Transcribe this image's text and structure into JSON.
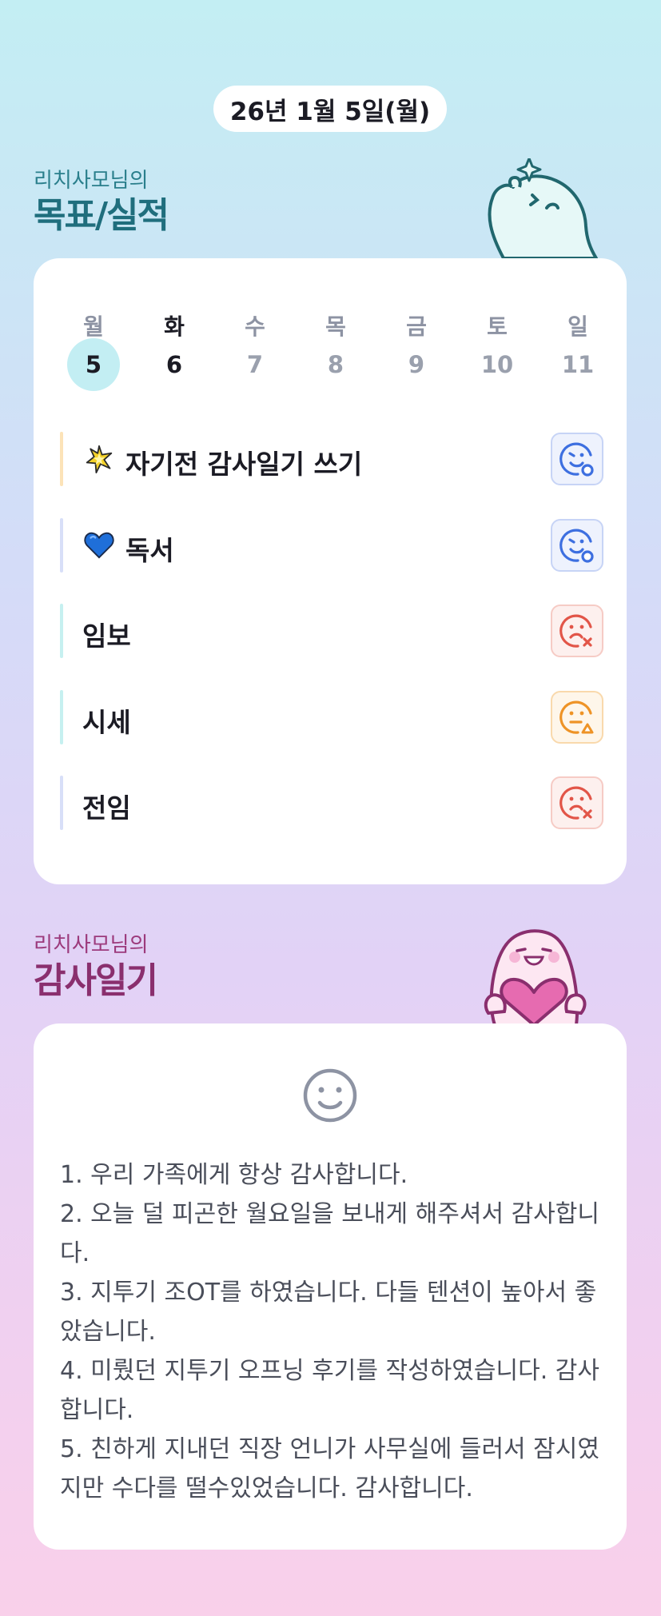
{
  "header": {
    "date": "26년 1월 5일(월)"
  },
  "goals_section": {
    "subtitle": "리치사모님의",
    "title": "목표/실적"
  },
  "week": {
    "weekdays": [
      "월",
      "화",
      "수",
      "목",
      "금",
      "토",
      "일"
    ],
    "days": [
      "5",
      "6",
      "7",
      "8",
      "9",
      "10",
      "11"
    ],
    "selected_index": 0,
    "today_index": 1
  },
  "goals": [
    {
      "emoji": "sparkle-star-icon",
      "label": "자기전 감사일기 쓰기",
      "bar_color": "#fce3b8",
      "status": "done",
      "status_color": "#3d6fe0"
    },
    {
      "emoji": "blue-heart-icon",
      "label": "독서",
      "bar_color": "#d8dff8",
      "status": "done",
      "status_color": "#3d6fe0"
    },
    {
      "emoji": "",
      "label": "임보",
      "bar_color": "#c6f0f0",
      "status": "failed",
      "status_color": "#e25548"
    },
    {
      "emoji": "",
      "label": "시세",
      "bar_color": "#c6f0f0",
      "status": "partial",
      "status_color": "#ee9326"
    },
    {
      "emoji": "",
      "label": "전임",
      "bar_color": "#d8dff8",
      "status": "failed",
      "status_color": "#e25548"
    }
  ],
  "diary_section": {
    "subtitle": "리치사모님의",
    "title": "감사일기"
  },
  "diary": {
    "mood_icon": "smile-face-icon",
    "lines": [
      "1. 우리 가족에게 항상 감사합니다.",
      "2. 오늘 덜 피곤한 월요일을 보내게 해주셔서 감사합니다.",
      "3. 지투기 조OT를 하였습니다. 다들 텐션이 높아서 좋았습니다.",
      "4. 미뤘던 지투기 오프닝 후기를 작성하였습니다. 감사합니다.",
      "5. 친하게 지내던 직장 언니가 사무실에 들러서 잠시였지만 수다를 떨수있었습니다. 감사합니다."
    ]
  },
  "colors": {
    "goals_title": "#1f6e7d",
    "diary_title": "#8a2f6e",
    "selected_day_bg": "#c3eef3"
  }
}
